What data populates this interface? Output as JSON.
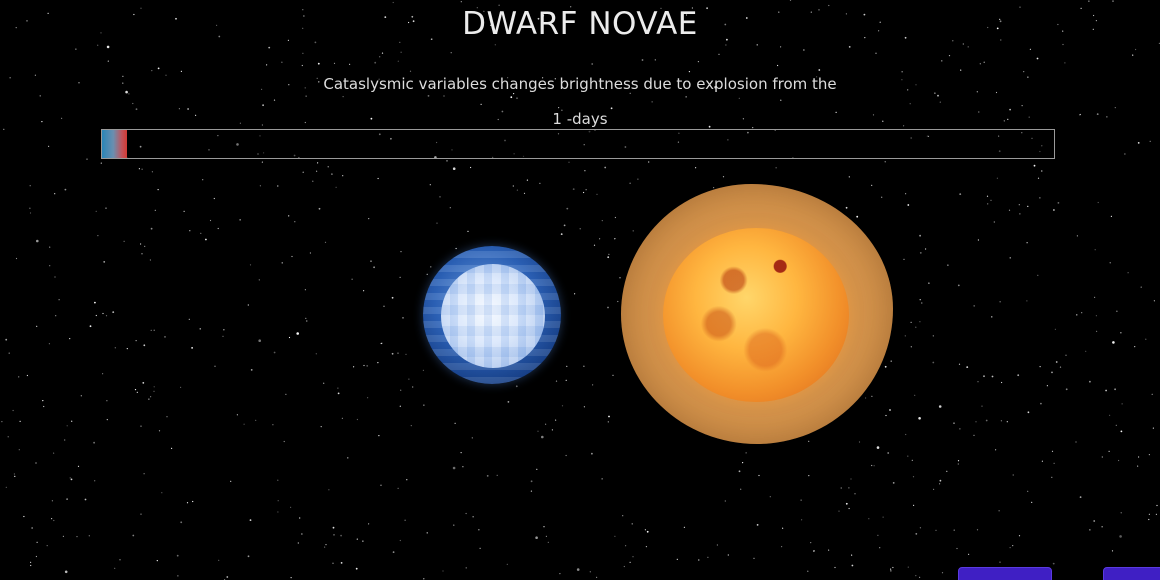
{
  "page": {
    "title": "DWARF NOVAE",
    "description": "Cataslysmic variables changes brightness due to explosion from the",
    "days_label": "1 -days"
  },
  "progress": {
    "fraction": 0.026,
    "colors": [
      "#2a86b8",
      "#6a8fb0",
      "#c2535b",
      "#d23a34"
    ]
  },
  "scene": {
    "background": "#000000",
    "bodies": [
      {
        "name": "white-dwarf",
        "color": "#2d63b8"
      },
      {
        "name": "companion-star",
        "color": "#f2902a"
      }
    ]
  },
  "nav": {
    "button_color": "#3f1fc4",
    "buttons": [
      {
        "name": "prev",
        "label": ""
      },
      {
        "name": "next",
        "label": ""
      }
    ]
  }
}
